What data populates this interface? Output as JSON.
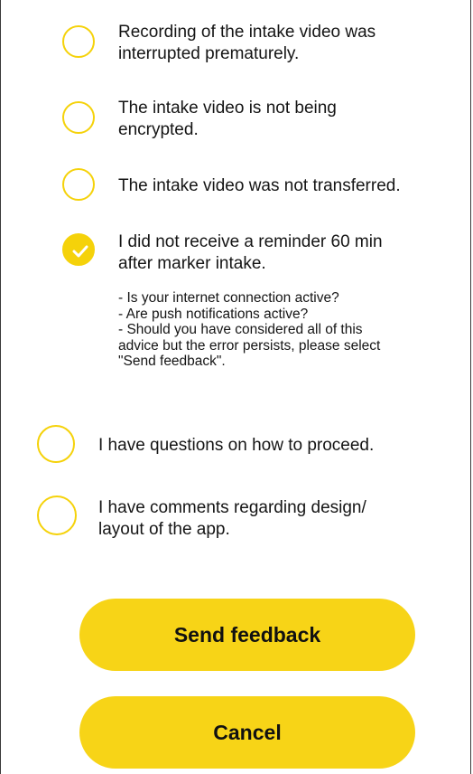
{
  "options": [
    {
      "label": "Recording of the intake video was\ninterrupted prematurely.",
      "checked": false
    },
    {
      "label": "The intake video is not being\nencrypted.",
      "checked": false
    },
    {
      "label": "The intake video was not transferred.",
      "checked": false
    },
    {
      "label": "I did not receive a reminder 60 min\nafter marker intake.",
      "checked": true
    },
    {
      "label": "I have questions on how to proceed.",
      "checked": false
    },
    {
      "label": "I have comments regarding design/\nlayout of the app.",
      "checked": false
    }
  ],
  "hint": {
    "lines": [
      "- Is your internet connection active?",
      "- Are push notifications active?",
      "- Should you have considered all of this\nadvice but the error persists, please select\n\"Send feedback\"."
    ]
  },
  "buttons": {
    "send_label": "Send feedback",
    "cancel_label": "Cancel"
  },
  "colors": {
    "accent": "#f5d20a",
    "button": "#f7d417"
  },
  "icons": {
    "checked": "checkmark-icon"
  }
}
